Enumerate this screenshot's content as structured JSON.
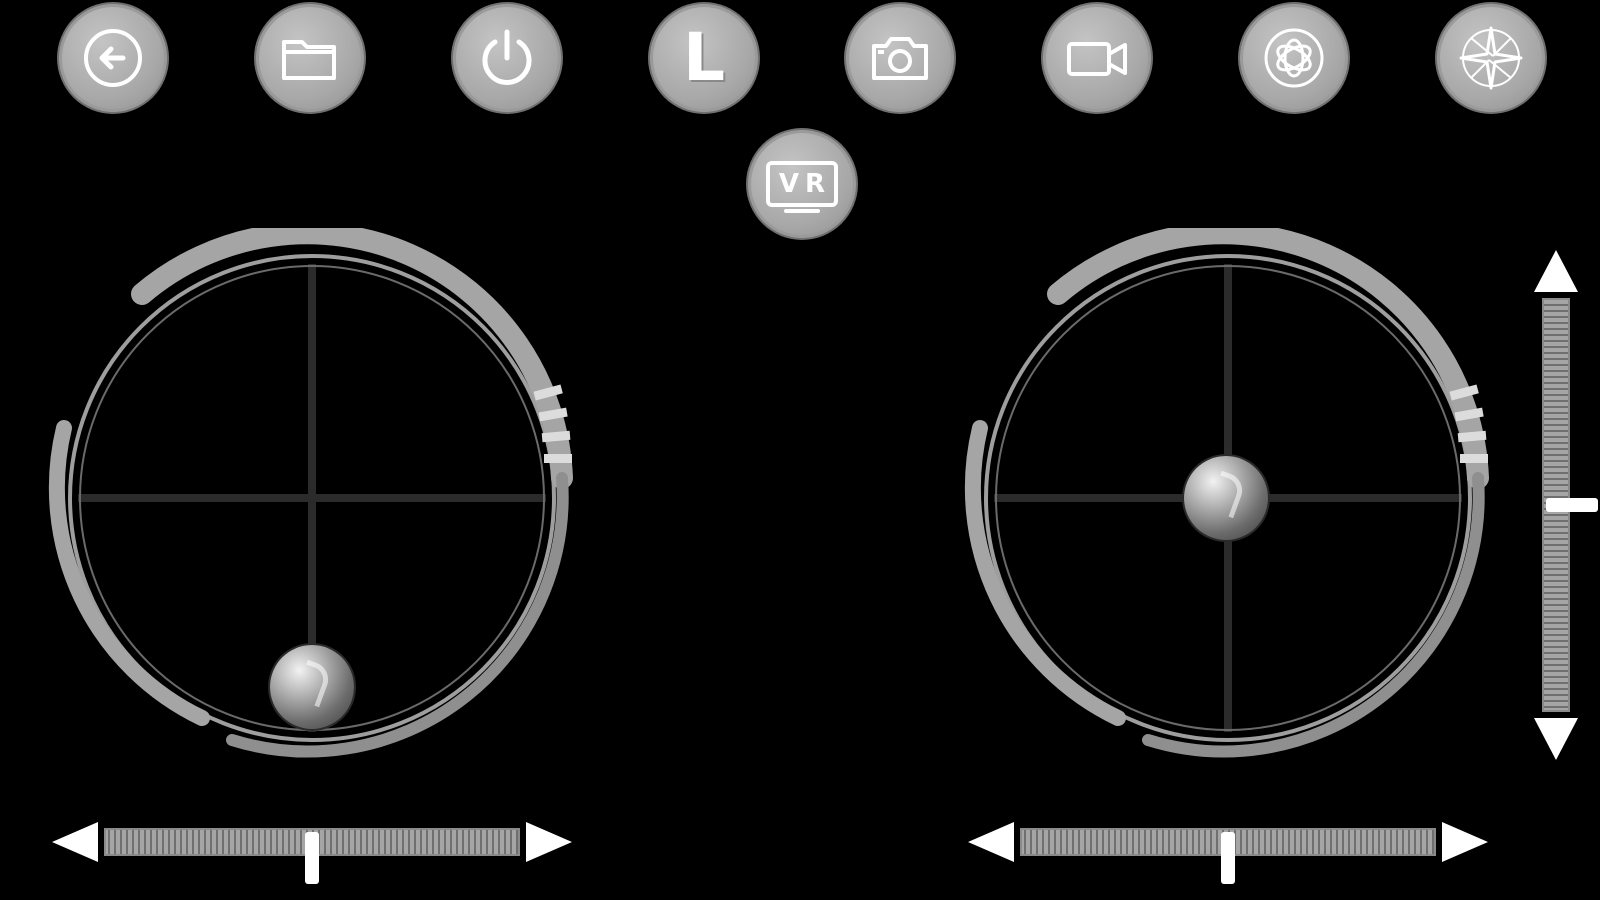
{
  "toolbar": {
    "buttons": [
      {
        "icon": "back-arrow-icon"
      },
      {
        "icon": "folder-icon"
      },
      {
        "icon": "power-icon"
      },
      {
        "icon": "headless-mode-icon",
        "label": "L"
      },
      {
        "icon": "camera-icon"
      },
      {
        "icon": "video-camera-icon"
      },
      {
        "icon": "gyro-calibrate-icon"
      },
      {
        "icon": "compass-icon"
      }
    ],
    "vr_button": {
      "icon": "vr-goggles-icon",
      "label": "VR"
    }
  },
  "left_joystick": {
    "knob_x": 0.0,
    "knob_y": -0.82
  },
  "right_joystick": {
    "knob_x": -0.01,
    "knob_y": 0.0
  },
  "left_trim": {
    "value": 0.5
  },
  "right_trim": {
    "value": 0.5
  },
  "vertical_trim": {
    "value": 0.5
  },
  "colors": {
    "background": "#000000",
    "button_face": "#a8a8a8",
    "ring": "#9e9e9e",
    "crosshair": "#2b2b2b",
    "accent": "#ffffff"
  }
}
